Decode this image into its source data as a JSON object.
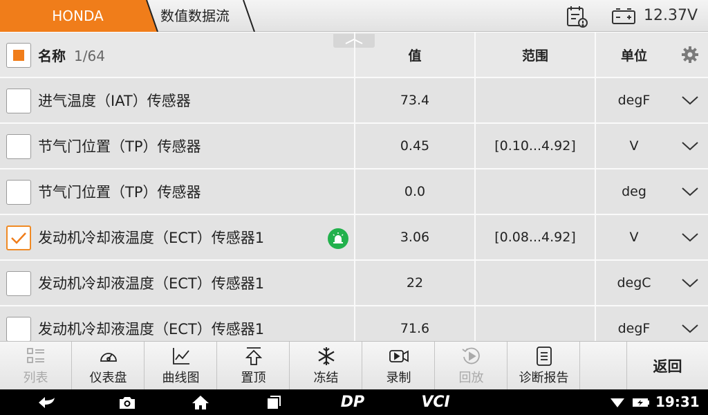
{
  "topbar": {
    "brand": "HONDA",
    "page_title": "数值数据流",
    "voltage": "12.37V"
  },
  "table": {
    "header": {
      "title": "名称",
      "count": "1/64",
      "value_col": "值",
      "range_col": "范围",
      "unit_col": "单位"
    },
    "rows": [
      {
        "name": "进气温度（IAT）传感器",
        "value": "73.4",
        "range": "",
        "unit": "degF",
        "checked": false
      },
      {
        "name": "节气门位置（TP）传感器",
        "value": "0.45",
        "range": "[0.10...4.92]",
        "unit": "V",
        "checked": false
      },
      {
        "name": "节气门位置（TP）传感器",
        "value": "0.0",
        "range": "",
        "unit": "deg",
        "checked": false
      },
      {
        "name": "发动机冷却液温度（ECT）传感器1",
        "value": "3.06",
        "range": "[0.08...4.92]",
        "unit": "V",
        "checked": true
      },
      {
        "name": "发动机冷却液温度（ECT）传感器1",
        "value": "22",
        "range": "",
        "unit": "degC",
        "checked": false
      },
      {
        "name": "发动机冷却液温度（ECT）传感器1",
        "value": "71.6",
        "range": "",
        "unit": "degF",
        "checked": false
      }
    ]
  },
  "toolbar": {
    "list": "列表",
    "gauge": "仪表盘",
    "graph": "曲线图",
    "pin_top": "置顶",
    "freeze": "冻结",
    "record": "录制",
    "playback": "回放",
    "report": "诊断报告",
    "back": "返回"
  },
  "navbar": {
    "dp_logo": "DP",
    "vci_label": "VCI",
    "time": "19:31"
  },
  "colors": {
    "accent": "#f07d1a",
    "row_bg": "#e3e3e3",
    "status_green": "#22b14c"
  }
}
